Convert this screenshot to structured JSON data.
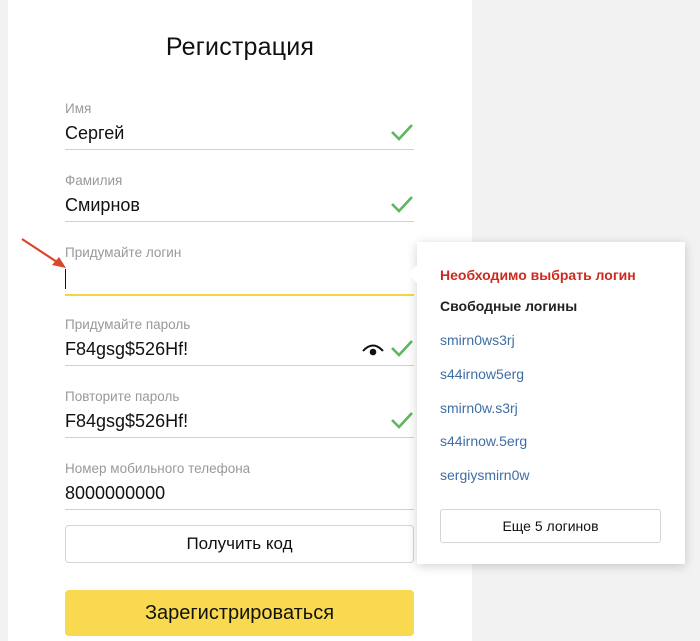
{
  "form": {
    "title": "Регистрация",
    "fields": [
      {
        "label": "Имя",
        "value": "Сергей"
      },
      {
        "label": "Фамилия",
        "value": "Смирнов"
      },
      {
        "label": "Придумайте логин",
        "value": ""
      },
      {
        "label": "Придумайте пароль",
        "value": "F84gsg$526Hf!"
      },
      {
        "label": "Повторите пароль",
        "value": "F84gsg$526Hf!"
      },
      {
        "label": "Номер мобильного телефона",
        "value": "8000000000"
      }
    ],
    "get_code_label": "Получить код",
    "register_label": "Зарегистрироваться"
  },
  "popup": {
    "error": "Необходимо выбрать логин",
    "heading": "Свободные логины",
    "logins": [
      "smirn0ws3rj",
      "s44irnow5erg",
      "smirn0w.s3rj",
      "s44irnow.5erg",
      "sergiysmirn0w"
    ],
    "more_label": "Еще 5 логинов"
  },
  "colors": {
    "accent_yellow": "#f8d94f",
    "check_green": "#5cb85c",
    "error_red": "#cc2a1f",
    "link_blue": "#3f6ea3",
    "arrow_red": "#d9472b"
  },
  "icons": {
    "check": "check-icon",
    "eye": "eye-icon",
    "arrow": "annotation-arrow"
  }
}
